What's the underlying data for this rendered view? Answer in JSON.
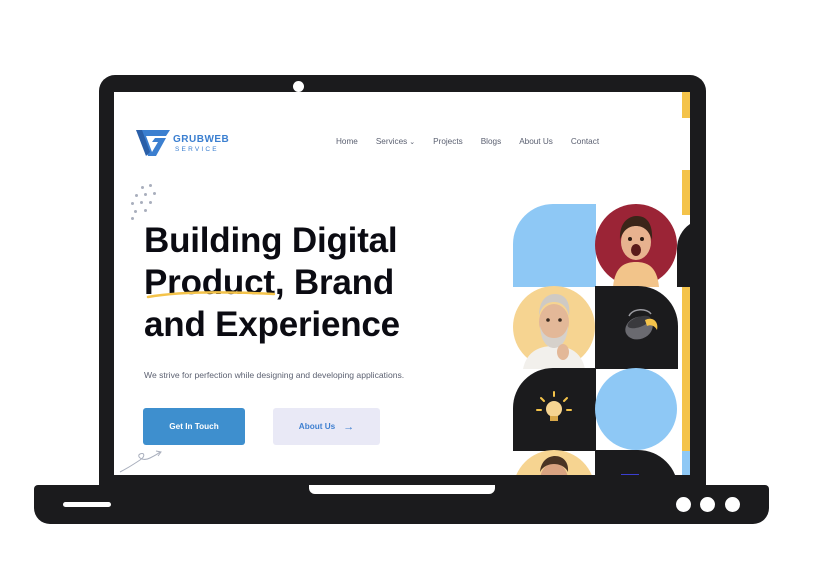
{
  "brand": {
    "name": "GRUBWEB",
    "tagline": "SERVICE",
    "color": "#3b7fd0"
  },
  "nav": {
    "items": [
      {
        "label": "Home"
      },
      {
        "label": "Services",
        "has_dropdown": true
      },
      {
        "label": "Projects"
      },
      {
        "label": "Blogs"
      },
      {
        "label": "About Us"
      },
      {
        "label": "Contact"
      }
    ],
    "chevron": "⌄"
  },
  "hero": {
    "title_lines": [
      "Building Digital",
      "Product, Brand",
      "and Experience"
    ],
    "subtitle": "We strive for perfection while designing and developing applications.",
    "primary_button": "Get In Touch",
    "secondary_button": "About Us",
    "secondary_icon": "arrow-right-icon",
    "highlight_color": "#f4c34a"
  },
  "colors": {
    "primary": "#3e8fce",
    "secondary_bg": "#e9e9f6",
    "dark": "#1b1b1d",
    "light_blue": "#8ec8f5",
    "yellow": "#f4c34a",
    "maroon": "#9b2436",
    "cream": "#f6d491"
  },
  "gallery": {
    "tiles": [
      {
        "name": "blue-petal-tile",
        "type": "shape"
      },
      {
        "name": "excited-woman-photo",
        "type": "photo"
      },
      {
        "name": "bearded-man-photo",
        "type": "photo"
      },
      {
        "name": "paint-bucket-icon",
        "type": "icon"
      },
      {
        "name": "lightbulb-icon",
        "type": "icon"
      },
      {
        "name": "blue-circle-tile",
        "type": "shape"
      },
      {
        "name": "smiling-man-photo",
        "type": "photo"
      },
      {
        "name": "dark-tile",
        "type": "shape"
      }
    ]
  }
}
